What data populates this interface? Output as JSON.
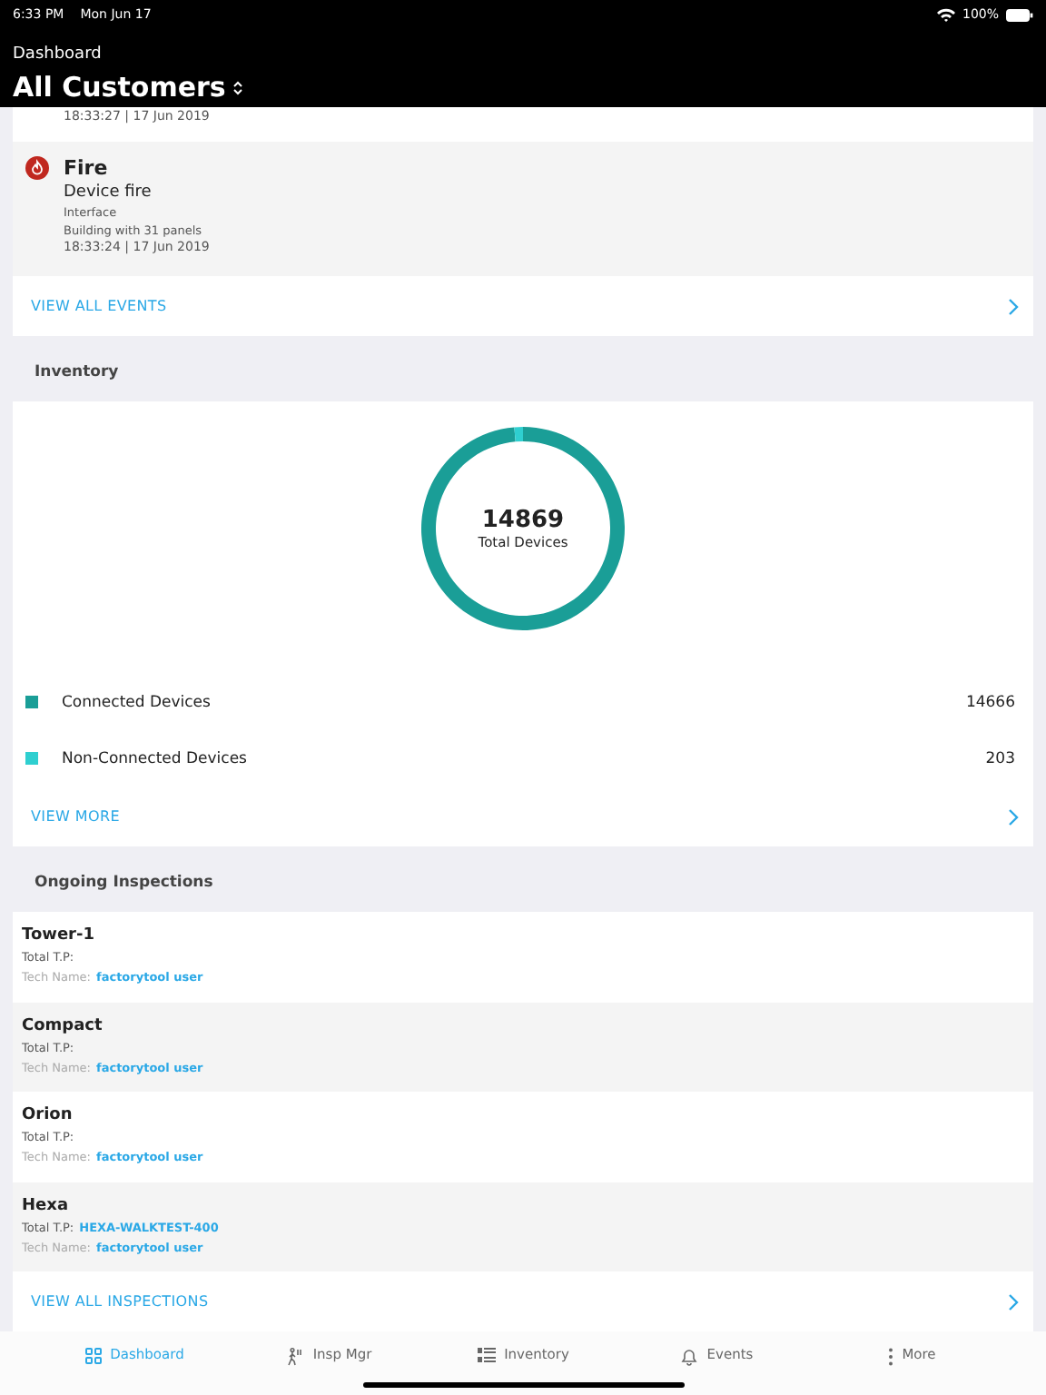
{
  "status_bar": {
    "time": "6:33 PM",
    "date": "Mon Jun 17",
    "battery": "100%"
  },
  "header": {
    "breadcrumb": "Dashboard",
    "title": "All Customers"
  },
  "events": [
    {
      "kind": "partial",
      "timestamp": "18:33:27  |  17 Jun 2019"
    },
    {
      "kind": "full",
      "type": "Fire",
      "description": "Device fire",
      "source": "Interface",
      "location": "Building with 31 panels",
      "timestamp": "18:33:24  |  17 Jun 2019"
    }
  ],
  "events_link": "VIEW ALL EVENTS",
  "inventory": {
    "heading": "Inventory",
    "total": "14869",
    "total_label": "Total Devices",
    "chart_data": {
      "type": "donut",
      "categories": [
        "Connected Devices",
        "Non-Connected Devices"
      ],
      "values": [
        98.63,
        1.37
      ]
    },
    "legend": [
      {
        "value": "14666",
        "color": "#1a9e97"
      },
      {
        "value": "203",
        "color": "#2fcfd0"
      }
    ],
    "link": "VIEW MORE"
  },
  "inspections": {
    "heading": "Ongoing Inspections",
    "items": [
      {
        "name": "Tower-1",
        "tp_label": "Total T.P:",
        "tech_label": "Tech Name:",
        "tech": "factorytool user"
      },
      {
        "name": "Compact",
        "tp_label": "Total T.P:",
        "tech_label": "Tech Name:",
        "tech": "factorytool user"
      },
      {
        "name": "Orion",
        "tp_label": "Total T.P:",
        "tech_label": "Tech Name:",
        "tech": "factorytool user"
      },
      {
        "name": "Hexa",
        "tp_label": "Total T.P:",
        "tp": "HEXA-WALKTEST-400",
        "tech_label": "Tech Name:",
        "tech": "factorytool user"
      }
    ],
    "link": "VIEW ALL INSPECTIONS"
  },
  "tab_bar": [
    {
      "label": "Dashboard",
      "kind": "grid",
      "selected": true
    },
    {
      "label": "Insp Mgr",
      "kind": "walker",
      "selected": false
    },
    {
      "label": "Inventory",
      "kind": "list",
      "selected": false
    },
    {
      "label": "Events",
      "kind": "bell",
      "selected": false
    },
    {
      "label": "More",
      "kind": "dots",
      "selected": false
    }
  ]
}
